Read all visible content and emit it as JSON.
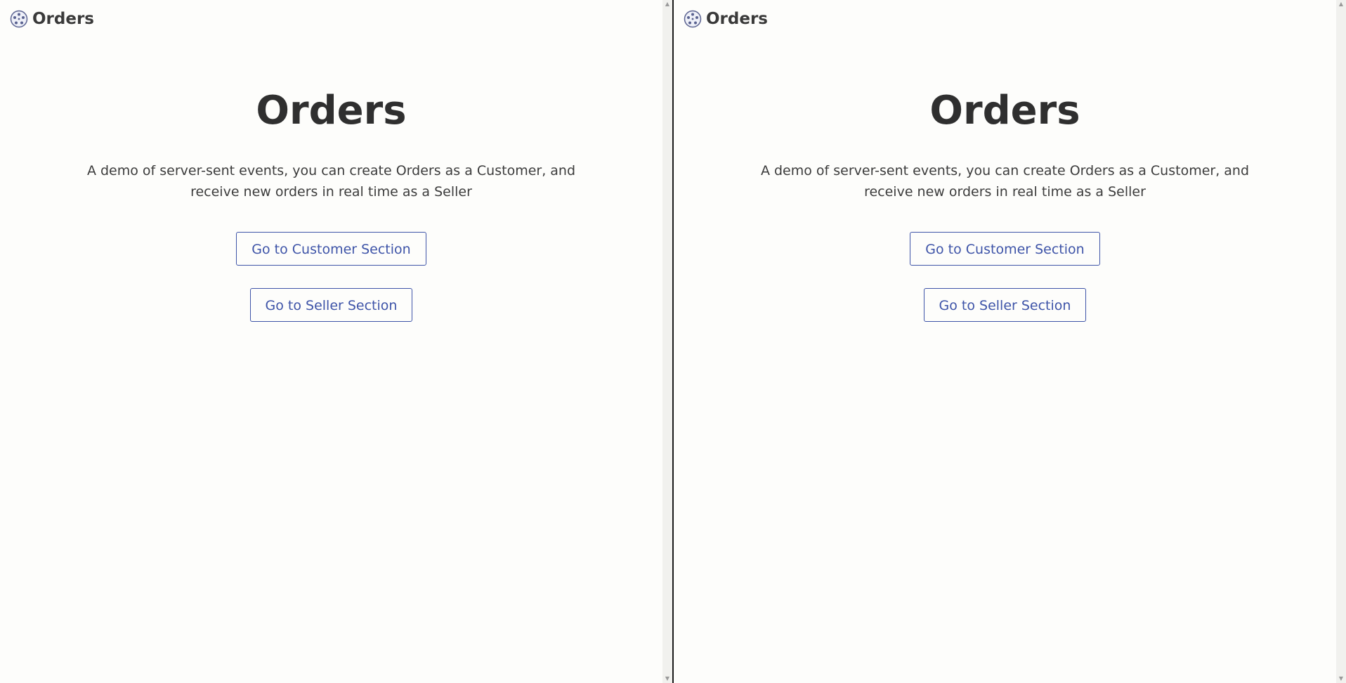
{
  "left_pane": {
    "brand_title": "Orders",
    "heading": "Orders",
    "description": "A demo of server-sent events, you can create Orders as a Customer, and receive new orders in real time as a Seller",
    "customer_button": "Go to Customer Section",
    "seller_button": "Go to Seller Section"
  },
  "right_pane": {
    "brand_title": "Orders",
    "heading": "Orders",
    "description": "A demo of server-sent events, you can create Orders as a Customer, and receive new orders in real time as a Seller",
    "customer_button": "Go to Customer Section",
    "seller_button": "Go to Seller Section"
  },
  "icons": {
    "brand": "globe-icon",
    "scroll_up": "arrow-up-icon",
    "scroll_down": "arrow-down-icon"
  },
  "colors": {
    "background": "#fdfdfb",
    "accent": "#3e54a8",
    "text": "#2f2f2f",
    "divider": "#1a1a1a"
  }
}
